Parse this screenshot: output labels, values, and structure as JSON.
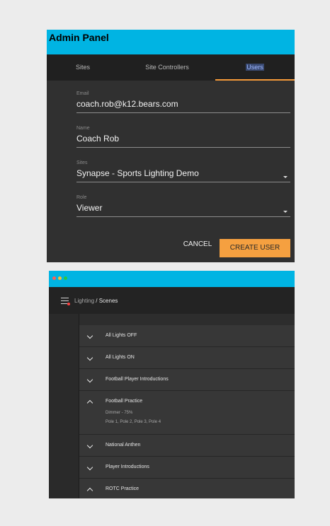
{
  "admin_panel": {
    "title": "Admin Panel",
    "tabs": [
      {
        "label": "Sites",
        "active": false
      },
      {
        "label": "Site Controllers",
        "active": false
      },
      {
        "label": "Users",
        "active": true
      }
    ],
    "fields": {
      "email": {
        "label": "Email",
        "value": "coach.rob@k12.bears.com"
      },
      "name": {
        "label": "Name",
        "value": "Coach Rob"
      },
      "sites": {
        "label": "Sites",
        "value": "Synapse - Sports Lighting Demo"
      },
      "role": {
        "label": "Role",
        "value": "Viewer"
      }
    },
    "buttons": {
      "cancel": "CANCEL",
      "create": "CREATE USER"
    },
    "colors": {
      "header": "#00b4e3",
      "accent": "#f5a040",
      "background": "#303030"
    }
  },
  "scenes_window": {
    "breadcrumb": {
      "section": "Lighting",
      "separator": " / ",
      "page": "Scenes"
    },
    "scenes": [
      {
        "title": "All Lights OFF",
        "expanded": false
      },
      {
        "title": "All Lights ON",
        "expanded": false
      },
      {
        "title": "Football Player Introductions",
        "expanded": false
      },
      {
        "title": "Football Practice",
        "expanded": true,
        "detail_1": "Dimmer - 75%",
        "detail_2": "Pole 1, Pole 2, Pole 3, Pole 4"
      },
      {
        "title": "National Anthen",
        "expanded": false
      },
      {
        "title": "Player Introductions",
        "expanded": false
      },
      {
        "title": "ROTC Practice",
        "expanded": true
      }
    ]
  }
}
